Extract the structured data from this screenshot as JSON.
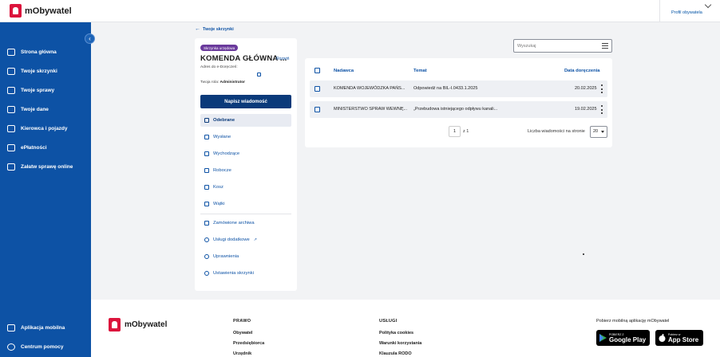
{
  "app": {
    "name": "mObywatel",
    "profile_label": "Profil obywatela"
  },
  "sidebar": {
    "items": [
      {
        "label": "Strona główna",
        "icon": "home-icon"
      },
      {
        "label": "Twoje skrzynki",
        "icon": "mailbox-icon"
      },
      {
        "label": "Twoje sprawy",
        "icon": "cases-icon"
      },
      {
        "label": "Twoje dane",
        "icon": "id-card-icon"
      },
      {
        "label": "Kierowca i pojazdy",
        "icon": "car-icon"
      },
      {
        "label": "ePłatności",
        "icon": "payments-icon"
      },
      {
        "label": "Załatw sprawę online",
        "icon": "services-icon"
      }
    ],
    "bottom": [
      {
        "label": "Aplikacja mobilna",
        "icon": "phone-icon"
      },
      {
        "label": "Centrum pomocy",
        "icon": "help-icon"
      }
    ]
  },
  "breadcrumb": {
    "back_label": "Twoje skrzynki"
  },
  "mailbox": {
    "badge": "Skrzynka urzędowa",
    "title": "KOMENDA GŁÓWNA ...",
    "expand_label": "Rozwiń",
    "address_label": "Adres do e-Doręczeń:",
    "role_label": "Twoja rola:",
    "role_value": "Administrator",
    "write_button": "Napisz wiadomość",
    "folders": [
      {
        "label": "Odebrane",
        "icon": "inbox-icon",
        "active": true
      },
      {
        "label": "Wysłane",
        "icon": "sent-icon"
      },
      {
        "label": "Wychodzące",
        "icon": "outbox-icon"
      },
      {
        "label": "Robocze",
        "icon": "pencil-icon"
      },
      {
        "label": "Kosz",
        "icon": "trash-icon"
      },
      {
        "label": "Wątki",
        "icon": "threads-icon"
      }
    ],
    "extras": [
      {
        "label": "Zamówione archiwa",
        "icon": "archive-icon"
      },
      {
        "label": "Usługi dodatkowe",
        "icon": "extra-services-icon"
      },
      {
        "label": "Uprawnienia",
        "icon": "permissions-icon"
      },
      {
        "label": "Ustawienia skrzynki",
        "icon": "settings-icon"
      }
    ]
  },
  "search": {
    "placeholder": "Wyszukaj"
  },
  "table": {
    "columns": {
      "sender": "Nadawca",
      "subject": "Temat",
      "date": "Data doręczenia"
    },
    "rows": [
      {
        "sender": "KOMENDA WOJEWÓDZKA PAŃS...",
        "subject": "Odpowiedź na BIL-I.0433.1.2025",
        "date": "20.02.2025"
      },
      {
        "sender": "MINISTERSTWO SPRAW WEWNĘ...",
        "subject": "„Przebudowa istniejącego odpływu kanali...",
        "date": "19.02.2025"
      }
    ],
    "pagination": {
      "page": "1",
      "of_label": "z 1",
      "per_page_label": "Liczba wiadomości na stronie",
      "per_page_value": "20"
    }
  },
  "footer": {
    "logo_text": "mObywatel",
    "law": {
      "title": "PRAWO",
      "links": [
        "Obywatel",
        "Przedsiębiorca",
        "Urzędnik"
      ]
    },
    "services": {
      "title": "USŁUGI",
      "links": [
        "Polityka cookies",
        "Warunki korzystania",
        "Klauzula RODO"
      ]
    },
    "app_title": "Pobierz mobilną aplikację mObywatel",
    "google": {
      "top": "POBIERZ Z",
      "main": "Google Play"
    },
    "apple": {
      "top": "Pobierz w",
      "main": "App Store"
    }
  }
}
